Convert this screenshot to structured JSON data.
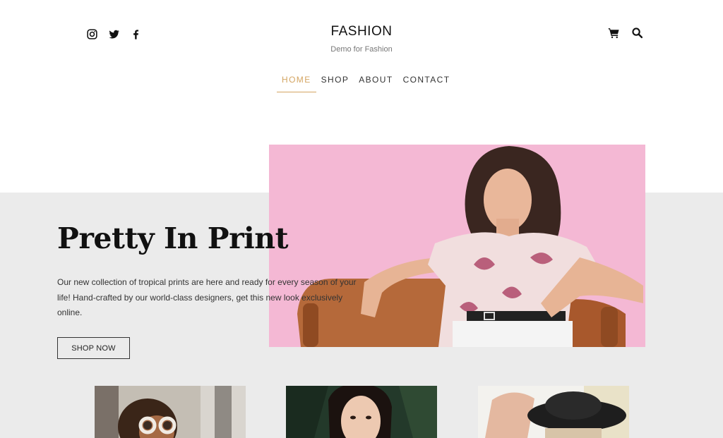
{
  "header": {
    "site_title": "FASHION",
    "tagline": "Demo for Fashion",
    "social_icons": [
      "instagram-icon",
      "twitter-icon",
      "facebook-icon"
    ],
    "tool_icons": [
      "cart-icon",
      "search-icon"
    ]
  },
  "nav": {
    "items": [
      {
        "label": "HOME",
        "active": true
      },
      {
        "label": "SHOP",
        "active": false
      },
      {
        "label": "ABOUT",
        "active": false
      },
      {
        "label": "CONTACT",
        "active": false
      }
    ]
  },
  "hero": {
    "title": "Pretty In Print",
    "description": "Our new collection of tropical prints are here and ready for every season of your life! Hand-crafted by our world-class designers, get this new look exclusively online.",
    "button_label": "SHOP NOW"
  },
  "colors": {
    "accent": "#d4a562",
    "hero_band": "#ebebeb",
    "hero_image_bg": "#f4b8d4"
  }
}
